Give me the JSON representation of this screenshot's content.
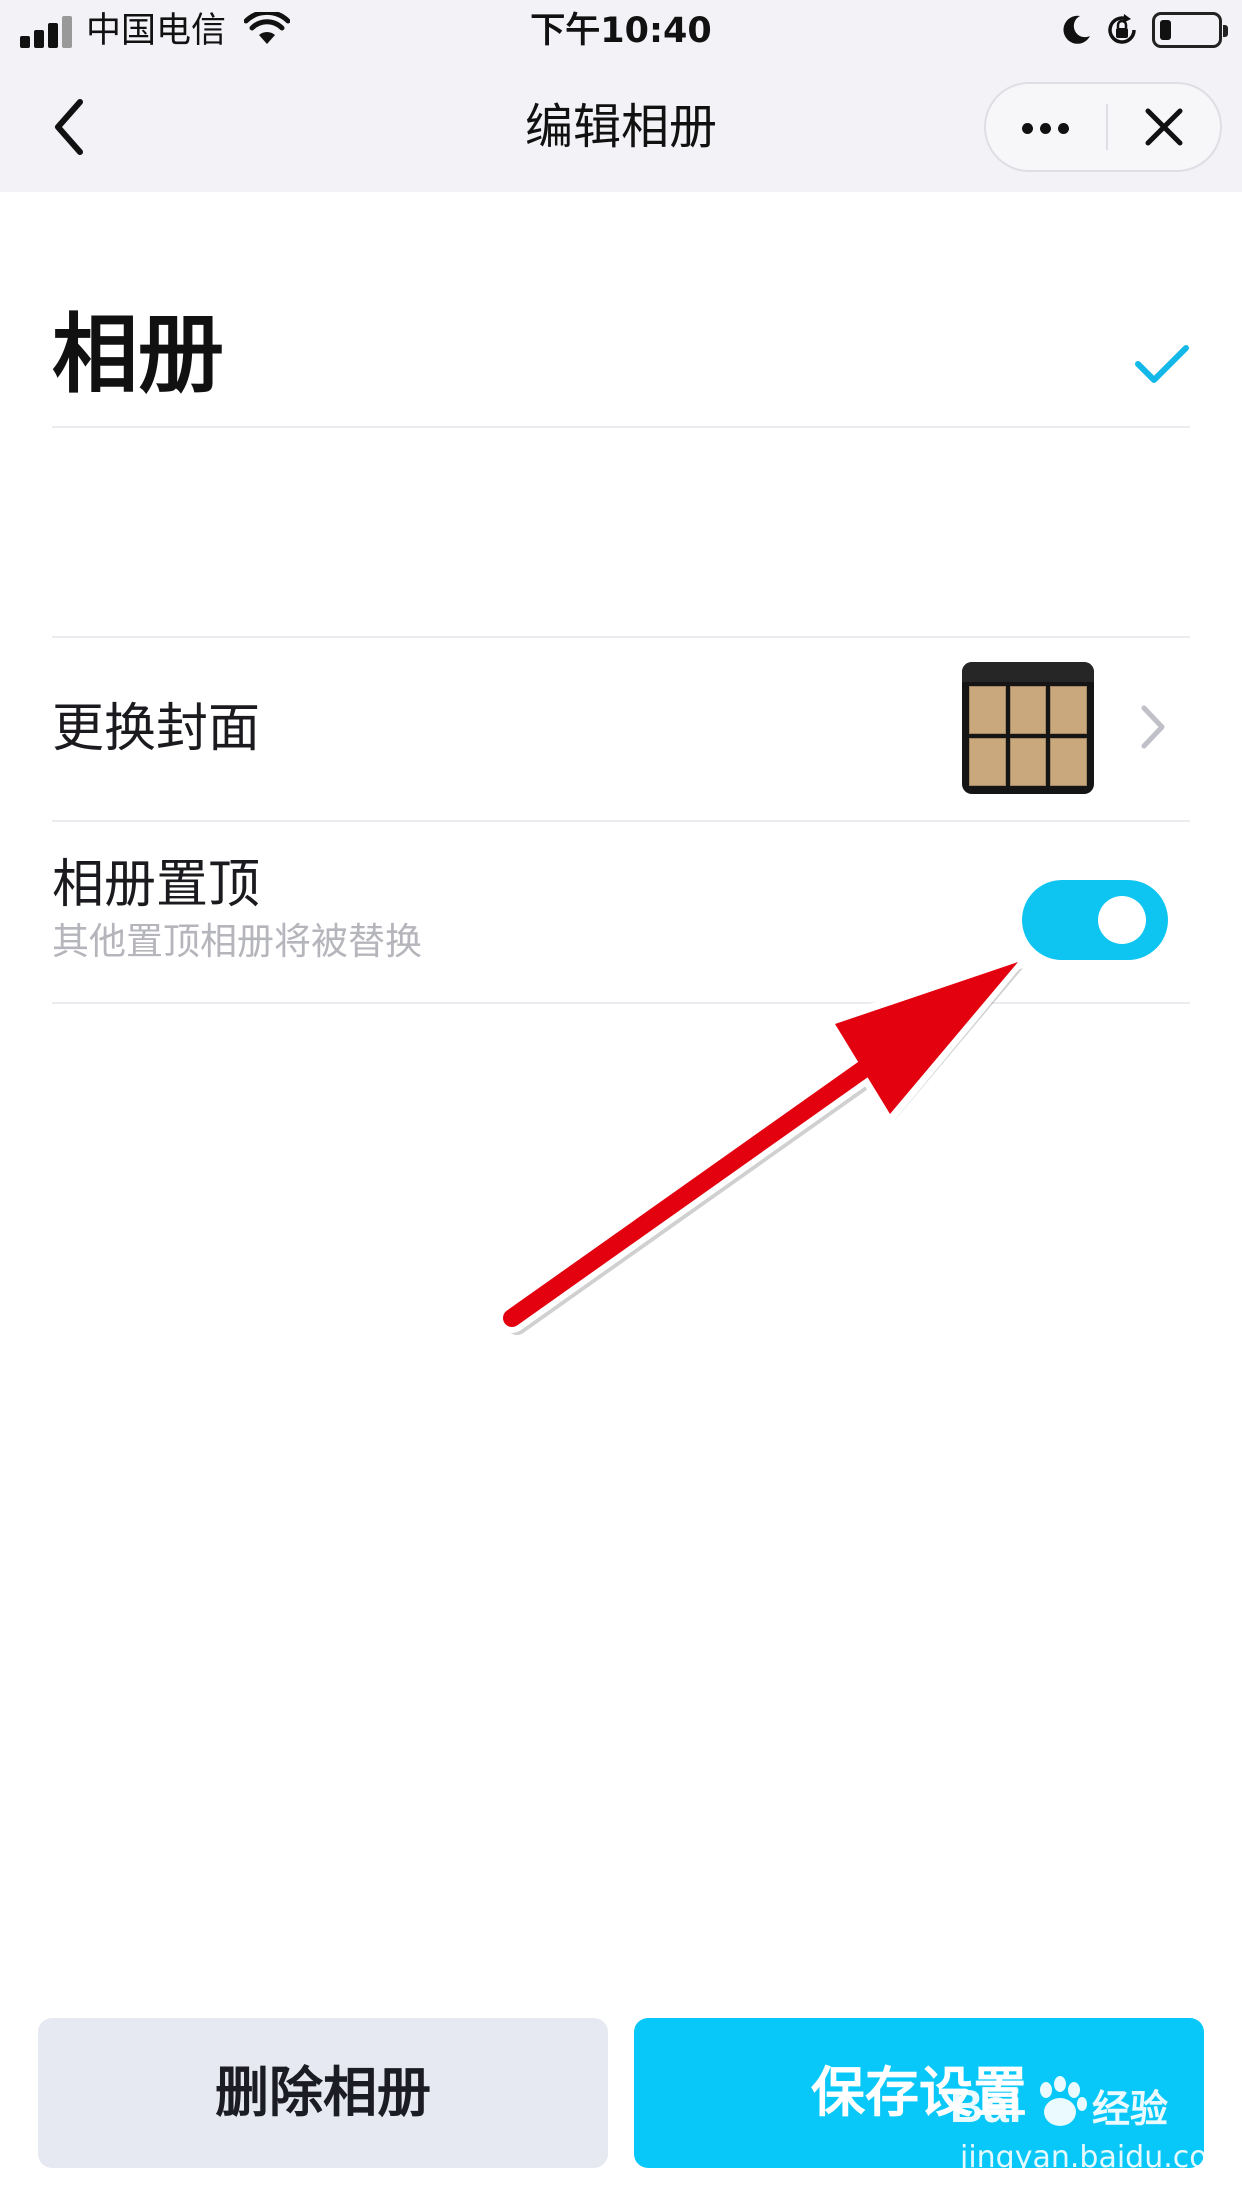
{
  "status_bar": {
    "carrier": "中国电信",
    "time": "下午10:40",
    "battery_level": 0.2
  },
  "nav": {
    "title": "编辑相册",
    "back_icon": "chevron-left-icon",
    "more_icon": "more-dots-icon",
    "close_icon": "close-icon"
  },
  "album": {
    "name": "相册",
    "confirm_icon": "checkmark-icon"
  },
  "settings": {
    "cover": {
      "label": "更换封面",
      "chevron_icon": "chevron-right-icon"
    },
    "pin": {
      "label": "相册置顶",
      "subtitle": "其他置顶相册将被替换",
      "enabled": true
    }
  },
  "buttons": {
    "delete": "删除相册",
    "save": "保存设置"
  },
  "watermark": {
    "logo": "Bai 经验",
    "url": "jingyan.baidu.com"
  },
  "colors": {
    "accent": "#07c8f8",
    "toggle_on": "#0ec4f1",
    "arrow": "#e3000f",
    "secondary_text": "#b5b5bc"
  }
}
